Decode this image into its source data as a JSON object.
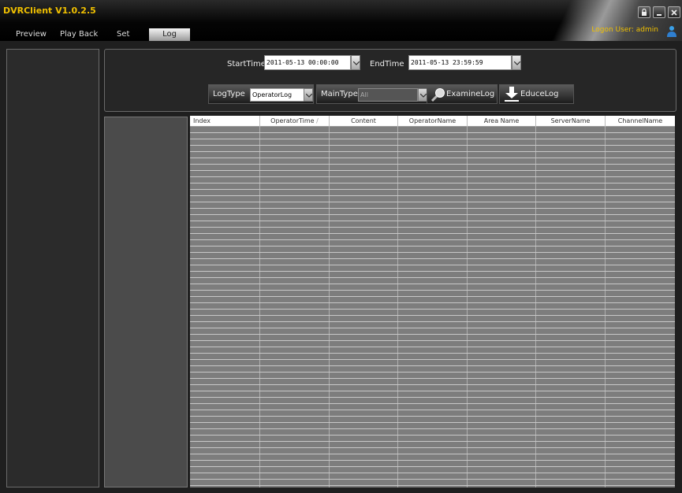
{
  "window": {
    "title": "DVRClient V1.0.2.5",
    "logon_user": "Logon User:  admin"
  },
  "menu": {
    "items": [
      {
        "label": "Preview"
      },
      {
        "label": "Play Back"
      },
      {
        "label": "Set"
      },
      {
        "label": "Log",
        "active": true
      }
    ]
  },
  "query": {
    "start_label": "StartTime",
    "start_value": "2011-05-13 00:00:00",
    "end_label": "EndTime",
    "end_value": "2011-05-13 23:59:59",
    "logtype_label": "LogType",
    "logtype_value": "OperatorLog",
    "maintype_label": "MainType",
    "maintype_value": "All",
    "examine_label": "ExamineLog",
    "educe_label": "EduceLog"
  },
  "table": {
    "columns": [
      "Index",
      "OperatorTime",
      "Content",
      "OperatorName",
      "Area Name",
      "ServerName",
      "ChannelName"
    ],
    "sorted_column": "OperatorTime",
    "rows": []
  },
  "colors": {
    "title_accent": "#f0c000",
    "background": "#1e1e1e"
  },
  "icons": [
    "lock-icon",
    "minimize-icon",
    "close-icon",
    "user-icon",
    "search-icon",
    "download-icon",
    "chevron-down-icon"
  ]
}
